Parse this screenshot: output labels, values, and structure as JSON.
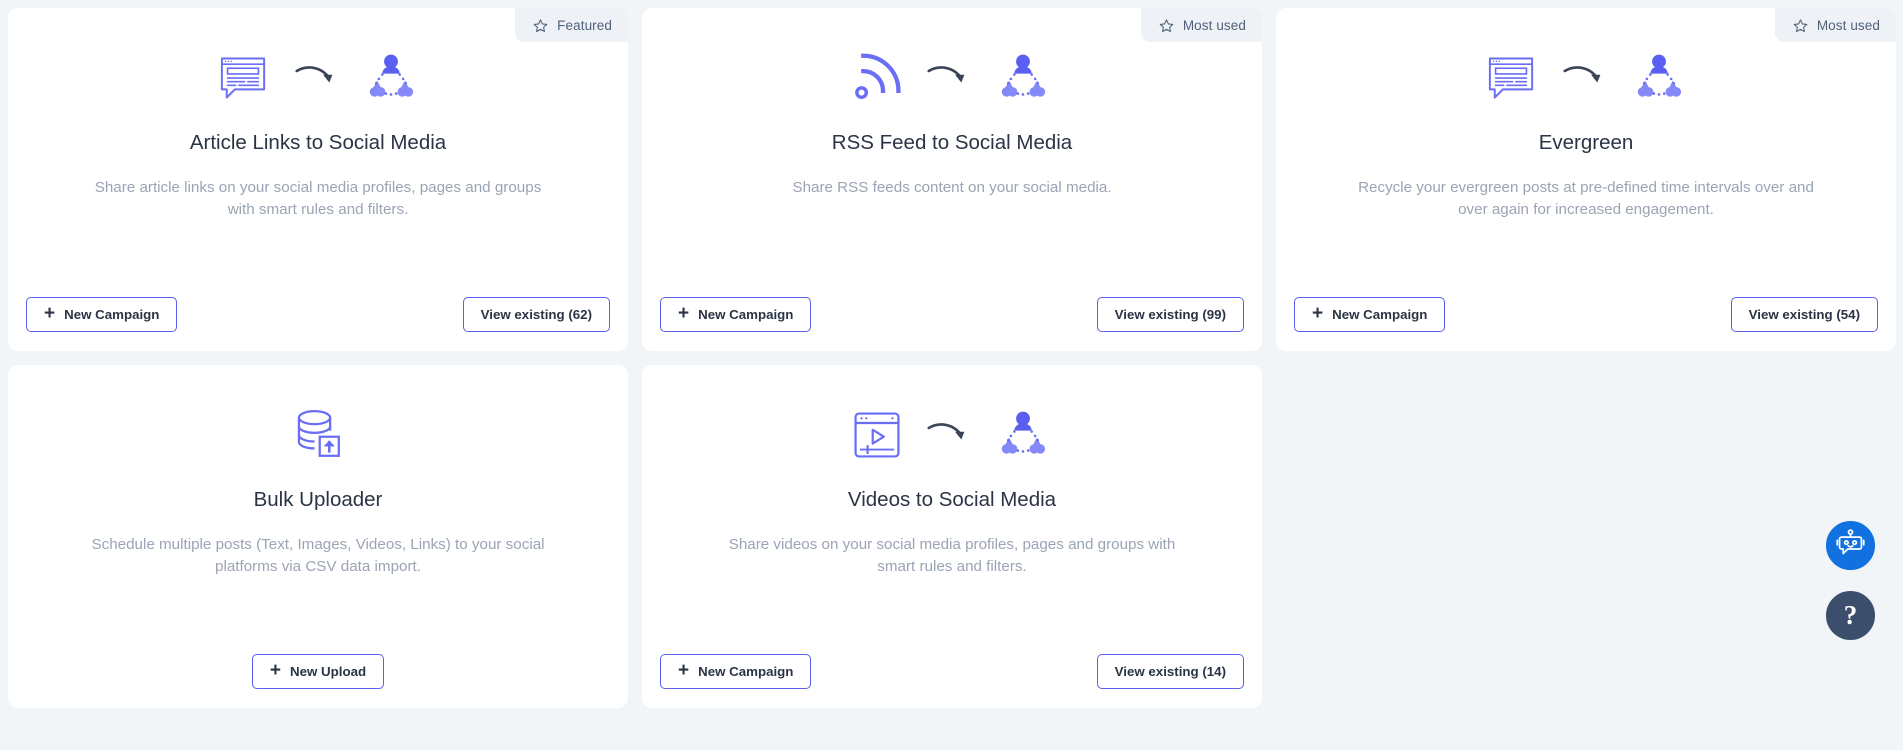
{
  "page": {
    "background_color": "#f1f5f8",
    "accent_color": "#5b5ff0",
    "title_color": "#2b3445",
    "desc_color": "#9ba4b4"
  },
  "cards": [
    {
      "id": "article-links-to-social-media",
      "badge": {
        "label": "Featured",
        "icon": "star-icon"
      },
      "icons": [
        "article-document-icon",
        "curved-arrow-icon",
        "social-network-people-icon"
      ],
      "title": "Article Links to Social Media",
      "description": "Share article links on your social media profiles, pages and groups with smart rules and filters.",
      "primary_button": {
        "label": "New Campaign",
        "icon": "plus-icon"
      },
      "secondary_button": {
        "label": "View existing (62)",
        "count": 62
      }
    },
    {
      "id": "rss-feed-to-social-media",
      "badge": {
        "label": "Most used",
        "icon": "star-icon"
      },
      "icons": [
        "rss-feed-icon",
        "curved-arrow-icon",
        "social-network-people-icon"
      ],
      "title": "RSS Feed to Social Media",
      "description": "Share RSS feeds content on your social media.",
      "primary_button": {
        "label": "New Campaign",
        "icon": "plus-icon"
      },
      "secondary_button": {
        "label": "View existing (99)",
        "count": 99
      }
    },
    {
      "id": "evergreen",
      "badge": {
        "label": "Most used",
        "icon": "star-icon"
      },
      "icons": [
        "article-document-icon",
        "curved-arrow-icon",
        "social-network-people-icon"
      ],
      "title": "Evergreen",
      "description": "Recycle your evergreen posts at pre-defined time intervals over and over again for increased engagement.",
      "primary_button": {
        "label": "New Campaign",
        "icon": "plus-icon"
      },
      "secondary_button": {
        "label": "View existing (54)",
        "count": 54
      }
    },
    {
      "id": "bulk-uploader",
      "badge": null,
      "icons": [
        "database-upload-icon"
      ],
      "title": "Bulk Uploader",
      "description": "Schedule multiple posts (Text, Images, Videos, Links) to your social platforms via CSV data import.",
      "primary_button": {
        "label": "New Upload",
        "icon": "plus-icon"
      },
      "secondary_button": null
    },
    {
      "id": "videos-to-social-media",
      "badge": null,
      "icons": [
        "video-player-icon",
        "curved-arrow-icon",
        "social-network-people-icon"
      ],
      "title": "Videos to Social Media",
      "description": "Share videos on your social media profiles, pages and groups with smart rules and filters.",
      "primary_button": {
        "label": "New Campaign",
        "icon": "plus-icon"
      },
      "secondary_button": {
        "label": "View existing (14)",
        "count": 14
      }
    }
  ],
  "floating_buttons": {
    "chatbot": {
      "icon": "robot-chat-icon",
      "color": "#1271e0"
    },
    "help": {
      "label": "?",
      "icon": "question-mark-icon",
      "color": "#3b4e6b"
    }
  }
}
